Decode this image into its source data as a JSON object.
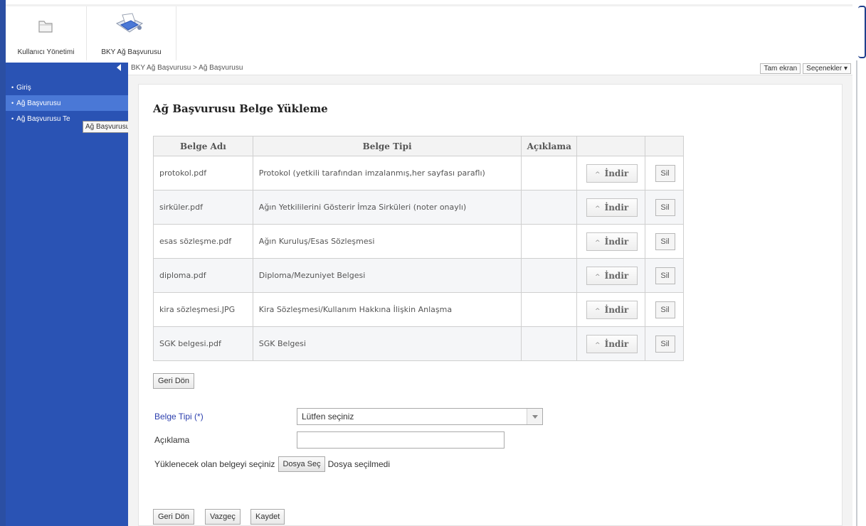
{
  "toolbar": {
    "items": [
      {
        "label": "Kullanıcı Yönetimi",
        "icon": "folder-icon"
      },
      {
        "label": "BKY Ağ Başvurusu",
        "icon": "network-application-icon"
      }
    ]
  },
  "sidebar": {
    "items": [
      {
        "label": "Giriş",
        "active": false
      },
      {
        "label": "Ağ Başvurusu",
        "active": true
      },
      {
        "label": "Ağ Başvurusu Te",
        "active": false
      }
    ],
    "tooltip": "Ağ Başvurusu"
  },
  "breadcrumb": {
    "path": "BKY Ağ Başvurusu  >  Ağ Başvurusu",
    "fullscreen_label": "Tam ekran",
    "options_label": "Seçenekler ▾"
  },
  "page": {
    "title": "Ağ Başvurusu Belge Yükleme"
  },
  "table": {
    "headers": [
      "Belge Adı",
      "Belge Tipi",
      "Açıklama",
      "",
      ""
    ],
    "download_label": "İndir",
    "delete_label": "Sil",
    "rows": [
      {
        "name": "protokol.pdf",
        "type": "Protokol (yetkili tarafından imzalanmış,her sayfası paraflı)",
        "desc": ""
      },
      {
        "name": "sirküler.pdf",
        "type": "Ağın Yetkililerini Gösterir İmza Sirküleri (noter onaylı)",
        "desc": ""
      },
      {
        "name": "esas sözleşme.pdf",
        "type": "Ağın Kuruluş/Esas Sözleşmesi",
        "desc": ""
      },
      {
        "name": "diploma.pdf",
        "type": "Diploma/Mezuniyet Belgesi",
        "desc": ""
      },
      {
        "name": "kira sözleşmesi.JPG",
        "type": "Kira Sözleşmesi/Kullanım Hakkına İlişkin Anlaşma",
        "desc": ""
      },
      {
        "name": "SGK belgesi.pdf",
        "type": "SGK Belgesi",
        "desc": ""
      }
    ]
  },
  "back_button_label": "Geri Dön",
  "form": {
    "doc_type_label": "Belge Tipi (*)",
    "doc_type_value": "Lütfen seçiniz",
    "description_label": "Açıklama",
    "description_value": "",
    "file_label": "Yüklenecek olan belgeyi seçiniz",
    "file_button_label": "Dosya Seç",
    "file_status": "Dosya seçilmedi"
  },
  "actions": {
    "back_label": "Geri Dön",
    "cancel_label": "Vazgeç",
    "save_label": "Kaydet"
  },
  "colors": {
    "sidebar_bg": "#2a53b4",
    "sidebar_active": "#4a78d6",
    "required_label": "#2c3fae"
  }
}
